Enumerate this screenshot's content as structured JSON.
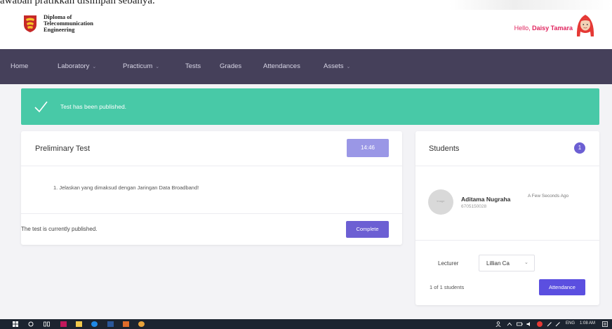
{
  "top_crop": {
    "text": "awabah pratikkan disimpan sebanya."
  },
  "header": {
    "brand_line1": "Diploma of",
    "brand_line2": "Telecommunication",
    "brand_line3": "Engineering",
    "greeting_prefix": "Hello,",
    "user_name": "Daisy Tamara"
  },
  "nav": {
    "items": [
      {
        "label": "Home",
        "dropdown": false
      },
      {
        "label": "Laboratory",
        "dropdown": true
      },
      {
        "label": "Practicum",
        "dropdown": true
      },
      {
        "label": "Tests",
        "dropdown": false
      },
      {
        "label": "Grades",
        "dropdown": false
      },
      {
        "label": "Attendances",
        "dropdown": false
      },
      {
        "label": "Assets",
        "dropdown": true
      }
    ],
    "chevron": "⌄"
  },
  "alert": {
    "message": "Test has been published.",
    "color": "#48c9a7"
  },
  "test_card": {
    "title": "Preliminary Test",
    "timer": "14:46",
    "question": "1. Jelaskan yang dimaksud dengan Jaringan Data Broadband!",
    "status": "The test is currently published.",
    "complete_label": "Complete"
  },
  "students_card": {
    "title": "Students",
    "count": "1",
    "student": {
      "name": "Aditama Nugraha",
      "id": "6705150028",
      "time": "A Few Seconds Ago",
      "avatar_text": "image"
    },
    "lecturer_label": "Lecturer",
    "lecturer_value": "Lillian Ca",
    "students_count": "1 of 1 students",
    "attendance_label": "Attendance"
  },
  "taskbar": {
    "lang": "ENG",
    "time": "1:08 AM"
  },
  "colors": {
    "nav_bg": "#45405a",
    "accent": "#6c5fd3",
    "timer_bg": "#9a97e6",
    "greeting": "#e0245e"
  }
}
